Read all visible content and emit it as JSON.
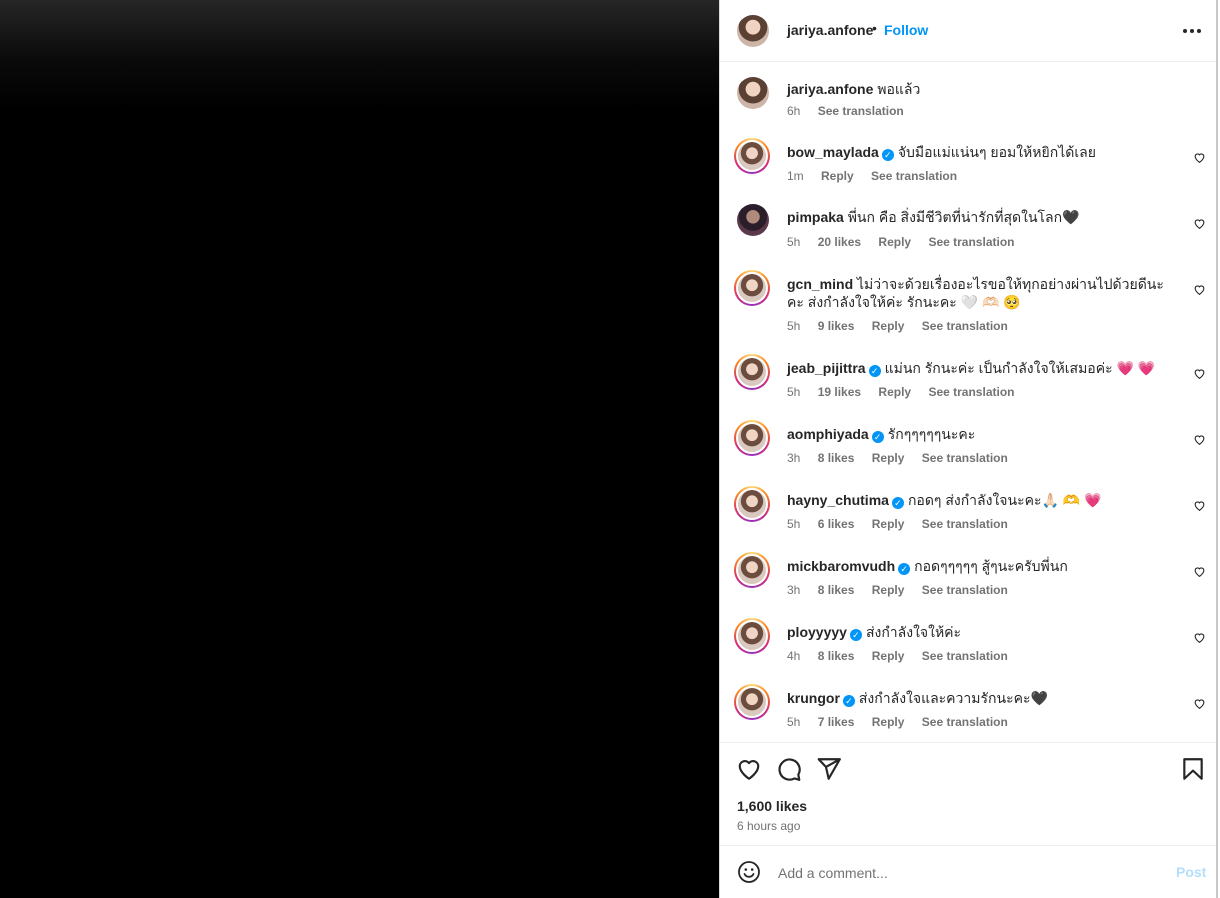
{
  "post": {
    "author": "jariya.anfone",
    "follow_label": "Follow",
    "dot": "•",
    "caption_author": "jariya.anfone",
    "caption_text": "พอแล้ว",
    "caption_time": "6h",
    "caption_see_translation": "See translation"
  },
  "comments": [
    {
      "user": "bow_maylada",
      "verified": true,
      "text": "จับมือแม่แน่นๆ ยอมให้หยิกได้เลย",
      "time": "1m",
      "likes": "",
      "reply": "Reply",
      "translate": "See translation"
    },
    {
      "user": "pimpaka",
      "verified": false,
      "text": "พี่นก คือ สิ่งมีชีวิตที่น่ารักที่สุดในโลก🖤",
      "time": "5h",
      "likes": "20 likes",
      "reply": "Reply",
      "translate": "See translation"
    },
    {
      "user": "gcn_mind",
      "verified": false,
      "text": "ไม่ว่าจะด้วยเรื่องอะไรขอให้ทุกอย่างผ่านไปด้วยดีนะคะ ส่งกำลังใจให้ค่ะ รักนะคะ 🤍 🫶🏻 🥺",
      "time": "5h",
      "likes": "9 likes",
      "reply": "Reply",
      "translate": "See translation"
    },
    {
      "user": "jeab_pijittra",
      "verified": true,
      "text": "แม่นก รักนะค่ะ เป็นกำลังใจให้เสมอค่ะ 💗 💗",
      "time": "5h",
      "likes": "19 likes",
      "reply": "Reply",
      "translate": "See translation"
    },
    {
      "user": "aomphiyada",
      "verified": true,
      "text": "รักๆๆๆๆๆนะคะ",
      "time": "3h",
      "likes": "8 likes",
      "reply": "Reply",
      "translate": "See translation"
    },
    {
      "user": "hayny_chutima",
      "verified": true,
      "text": "กอดๆ ส่งกำลังใจนะคะ🙏🏻 🫶 💗",
      "time": "5h",
      "likes": "6 likes",
      "reply": "Reply",
      "translate": "See translation"
    },
    {
      "user": "mickbaromvudh",
      "verified": true,
      "text": "กอดๆๆๆๆๆ สู้ๆนะครับพี่นก",
      "time": "3h",
      "likes": "8 likes",
      "reply": "Reply",
      "translate": "See translation"
    },
    {
      "user": "ployyyyy",
      "verified": true,
      "text": "ส่งกำลังใจให้ค่ะ",
      "time": "4h",
      "likes": "8 likes",
      "reply": "Reply",
      "translate": "See translation"
    },
    {
      "user": "krungor",
      "verified": true,
      "text": "ส่งกำลังใจและความรักนะคะ🖤",
      "time": "5h",
      "likes": "7 likes",
      "reply": "Reply",
      "translate": "See translation"
    }
  ],
  "footer": {
    "likes": "1,600 likes",
    "time": "6 hours ago",
    "comment_placeholder": "Add a comment...",
    "post_label": "Post"
  },
  "colors": {
    "accent": "#0095f6",
    "muted": "#737373",
    "post_disabled": "#b2dffc"
  }
}
